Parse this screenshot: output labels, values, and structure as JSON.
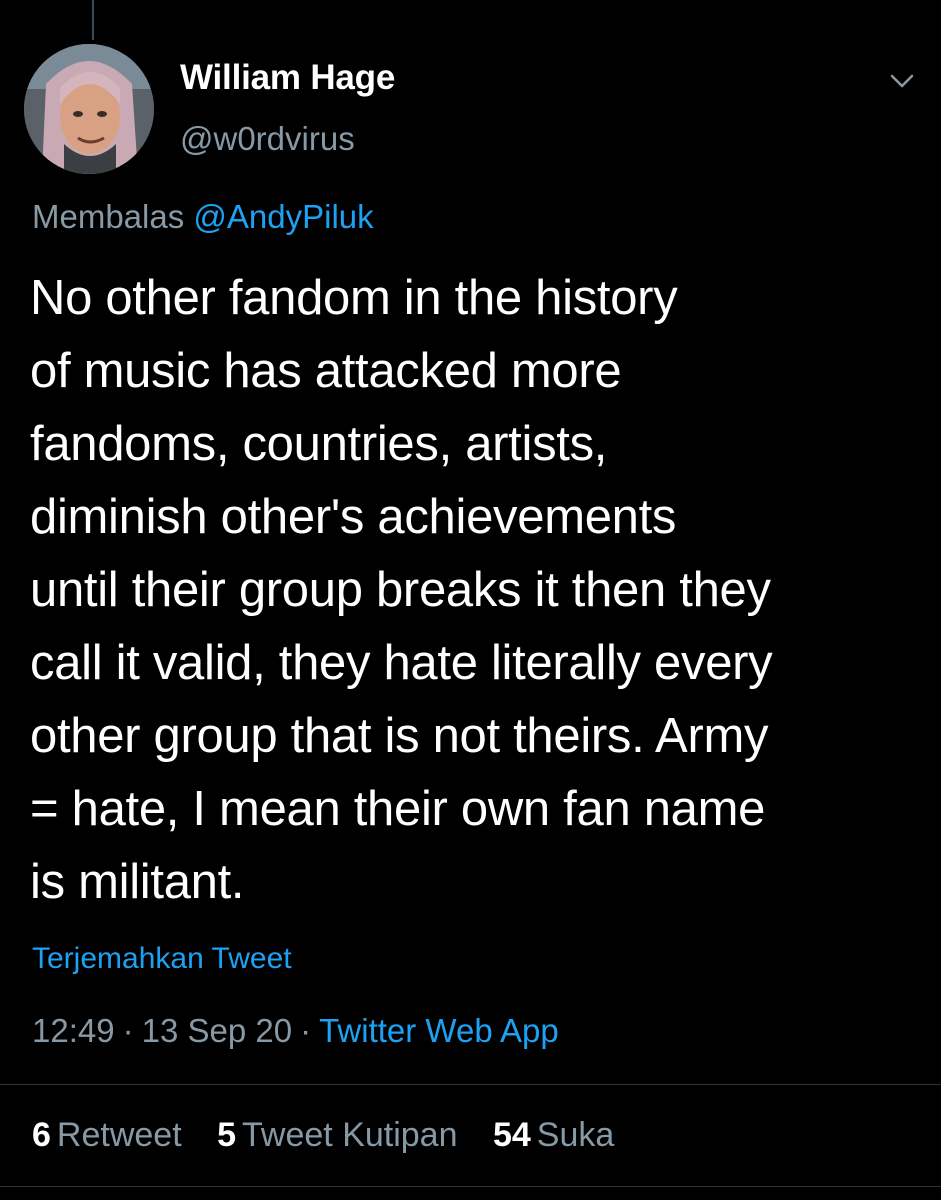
{
  "author": {
    "display_name": "William Hage",
    "handle": "@w0rdvirus"
  },
  "reply": {
    "prefix": "Membalas",
    "to": "@AndyPiluk"
  },
  "tweet": {
    "lines": [
      "No other fandom in the history",
      "of music has attacked more",
      "fandoms, countries, artists,",
      "diminish other's achievements",
      "until their group breaks it then they",
      "call it valid, they hate literally every",
      "other group that is not theirs. Army",
      "= hate, I mean their own fan name",
      "is militant."
    ]
  },
  "translate_label": "Terjemahkan Tweet",
  "meta": {
    "time": "12:49",
    "separator": "·",
    "date": "13 Sep 20",
    "source": "Twitter Web App"
  },
  "stats": {
    "retweets_count": "6",
    "retweets_label": "Retweet",
    "quotes_count": "5",
    "quotes_label": "Tweet Kutipan",
    "likes_count": "54",
    "likes_label": "Suka"
  },
  "colors": {
    "background": "#000000",
    "text": "#ffffff",
    "secondary": "#8899a6",
    "link": "#1da1f2",
    "divider": "#2f3336"
  },
  "icons": {
    "menu": "chevron-down-icon"
  }
}
